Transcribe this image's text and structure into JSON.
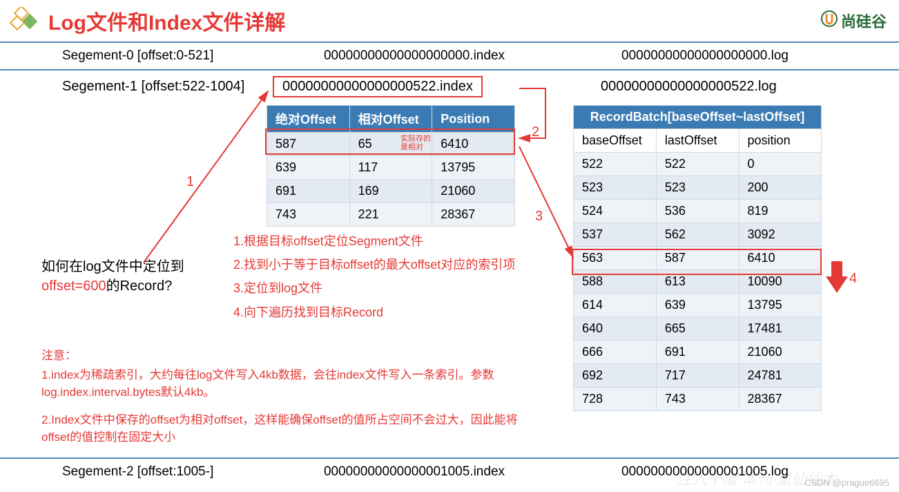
{
  "title": "Log文件和Index文件详解",
  "brand_text": "尚硅谷",
  "segments": {
    "s0": {
      "label": "Segement-0 [offset:0-521]",
      "index": "00000000000000000000.index",
      "log": "00000000000000000000.log"
    },
    "s1": {
      "label": "Segement-1 [offset:522-1004]",
      "index": "00000000000000000522.index",
      "log": "00000000000000000522.log"
    },
    "s2": {
      "label": "Segement-2 [offset:1005-]",
      "index": "00000000000000001005.index",
      "log": "00000000000000001005.log"
    }
  },
  "index_table": {
    "headers": {
      "c1": "绝对Offset",
      "c2": "相对Offset",
      "c3": "Position"
    },
    "rows": [
      {
        "abs": "587",
        "rel": "65",
        "pos": "6410"
      },
      {
        "abs": "639",
        "rel": "117",
        "pos": "13795"
      },
      {
        "abs": "691",
        "rel": "169",
        "pos": "21060"
      },
      {
        "abs": "743",
        "rel": "221",
        "pos": "28367"
      }
    ],
    "annotation": "实际存的\n是相对"
  },
  "log_table": {
    "header": "RecordBatch[baseOffset~lastOffset]",
    "sub": {
      "c1": "baseOffset",
      "c2": "lastOffset",
      "c3": "position"
    },
    "rows": [
      {
        "b": "522",
        "l": "522",
        "p": "0"
      },
      {
        "b": "523",
        "l": "523",
        "p": "200"
      },
      {
        "b": "524",
        "l": "536",
        "p": "819"
      },
      {
        "b": "537",
        "l": "562",
        "p": "3092"
      },
      {
        "b": "563",
        "l": "587",
        "p": "6410"
      },
      {
        "b": "588",
        "l": "613",
        "p": "10090"
      },
      {
        "b": "614",
        "l": "639",
        "p": "13795"
      },
      {
        "b": "640",
        "l": "665",
        "p": "17481"
      },
      {
        "b": "666",
        "l": "691",
        "p": "21060"
      },
      {
        "b": "692",
        "l": "717",
        "p": "24781"
      },
      {
        "b": "728",
        "l": "743",
        "p": "28367"
      }
    ]
  },
  "question": {
    "line1": "如何在log文件中定位到",
    "accent": "offset=600",
    "line2_rest": "的Record?"
  },
  "steps": {
    "s1": "1.根据目标offset定位Segment文件",
    "s2": "2.找到小于等于目标offset的最大offset对应的索引项",
    "s3": "3.定位到log文件",
    "s4": "4.向下遍历找到目标Record"
  },
  "notes": {
    "heading": "注意：",
    "n1": "1.index为稀疏索引，大约每往log文件写入4kb数据，会往index文件写入一条索引。参数log.index.interval.bytes默认4kb。",
    "n2": "2.Index文件中保存的offset为相对offset，这样能确保offset的值所占空间不会过大，因此能将offset的值控制在固定大小"
  },
  "labels": {
    "l1": "1",
    "l2": "2",
    "l3": "3",
    "l4": "4"
  },
  "watermark": "CSDN @prague6695"
}
